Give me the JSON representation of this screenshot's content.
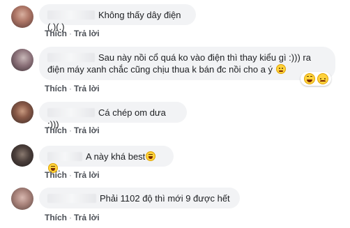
{
  "comments": [
    {
      "text": "Không thấy dây điện (.)(.)",
      "actions": {
        "like": "Thích",
        "reply": "Trả lời"
      },
      "avatar_color": "#9e6a5a"
    },
    {
      "text_line1": "Sau này nồi cổ quá ko vào điện thì thay kiểu gì :))) ra",
      "text_line2": "điện máy xanh chắc cũng chịu thua k bán đc nồi cho a ý",
      "emoji": "sweat-smile-icon",
      "reactions": [
        "laughing-icon",
        "crying-icon"
      ],
      "actions": {
        "like": "Thích",
        "reply": "Trả lời"
      },
      "avatar_color": "#6b5a5e"
    },
    {
      "text": "Cá chép om dưa :)))",
      "actions": {
        "like": "Thích",
        "reply": "Trả lời"
      },
      "avatar_color": "#7a4a3a"
    },
    {
      "text": "A này khá best",
      "text_suffix": ".",
      "emoji": [
        "laughing-icon",
        "laughing-icon"
      ],
      "actions": {
        "like": "Thích",
        "reply": "Trả lời"
      },
      "avatar_color": "#3d3636"
    },
    {
      "text": "Phải 1102 độ thì mới 9 được hết",
      "actions": {
        "like": "Thích",
        "reply": "Trả lời"
      },
      "avatar_color": "#a07a6c"
    }
  ],
  "colors": {
    "bubble": "#f2f3f5",
    "action_text": "#4b4f56",
    "emoji_yellow": "#ffd23c"
  }
}
